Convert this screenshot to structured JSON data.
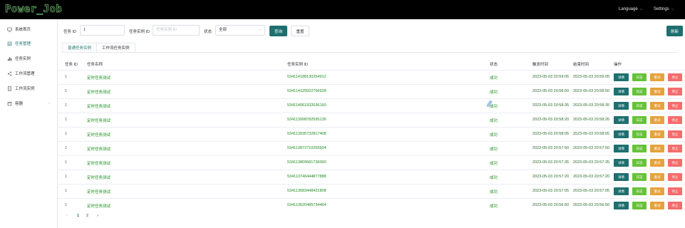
{
  "header": {
    "logo": "Power_Job",
    "language_label": "Language",
    "settings_label": "Settings"
  },
  "sidebar": {
    "items": [
      {
        "label": "系统首页",
        "icon": "monitor-icon"
      },
      {
        "label": "任务管理",
        "icon": "task-icon",
        "active": true
      },
      {
        "label": "任务实例",
        "icon": "bar-chart-icon"
      },
      {
        "label": "工作流管理",
        "icon": "share-icon"
      },
      {
        "label": "工作流实例",
        "icon": "document-icon"
      },
      {
        "label": "容器",
        "icon": "box-icon",
        "expandable": true
      }
    ]
  },
  "filters": {
    "task_id_label": "任务 ID",
    "task_id_value": "1",
    "instance_id_label": "任务实例 ID",
    "instance_id_placeholder": "任务实例 ID",
    "status_label": "状态",
    "status_value": "全部",
    "query_label": "查询",
    "reset_label": "重置",
    "refresh_label": "刷新"
  },
  "tabs": [
    {
      "label": "普通任务实例",
      "active": true
    },
    {
      "label": "工作流任务实例",
      "active": false
    }
  ],
  "table": {
    "headers": [
      "任务 ID",
      "任务名称",
      "任务实例 ID",
      "状态",
      "触发时间",
      "结束时间",
      "操作"
    ],
    "rows": [
      {
        "task_id": "1",
        "name": "定时任务测试",
        "instance_id": "534114188130254912",
        "status": "成功",
        "trigger": "2023-05-03 20:59:05",
        "end": "2023-05-03 20:59:05"
      },
      {
        "task_id": "1",
        "name": "定时任务测试",
        "instance_id": "534114125022756928",
        "status": "成功",
        "trigger": "2023-05-03 20:58:50",
        "end": "2023-05-03 20:58:50"
      },
      {
        "task_id": "1",
        "name": "定时任务测试",
        "instance_id": "534114061932036160",
        "status": "成功",
        "trigger": "2023-05-03 20:58:35",
        "end": "2023-05-03 20:58:35"
      },
      {
        "task_id": "1",
        "name": "定时任务测试",
        "instance_id": "534113998782595136",
        "status": "成功",
        "trigger": "2023-05-03 20:58:20",
        "end": "2023-05-03 20:58:20"
      },
      {
        "task_id": "1",
        "name": "定时任务测试",
        "instance_id": "534113935732817408",
        "status": "成功",
        "trigger": "2023-05-03 20:58:05",
        "end": "2023-05-03 20:58:05"
      },
      {
        "task_id": "1",
        "name": "定时任务测试",
        "instance_id": "534113872710255504",
        "status": "成功",
        "trigger": "2023-05-03 20:57:50",
        "end": "2023-05-03 20:57:50"
      },
      {
        "task_id": "1",
        "name": "定时任务测试",
        "instance_id": "534113809581736000",
        "status": "成功",
        "trigger": "2023-05-03 20:57:35",
        "end": "2023-05-03 20:57:35"
      },
      {
        "task_id": "1",
        "name": "定时任务测试",
        "instance_id": "534113746444877888",
        "status": "成功",
        "trigger": "2023-05-03 20:57:20",
        "end": "2023-05-03 20:57:20"
      },
      {
        "task_id": "1",
        "name": "定时任务测试",
        "instance_id": "534113683448431808",
        "status": "成功",
        "trigger": "2023-05-03 20:57:05",
        "end": "2023-05-03 20:57:05"
      },
      {
        "task_id": "1",
        "name": "定时任务测试",
        "instance_id": "534113620485734464",
        "status": "成功",
        "trigger": "2023-05-03 20:56:50",
        "end": "2023-05-03 20:56:50"
      }
    ],
    "actions": {
      "detail": "详情",
      "run": "日志",
      "copy": "重试",
      "stop": "停止"
    }
  },
  "pagination": {
    "prev": "‹",
    "pages": [
      "1",
      "2"
    ],
    "next": "›"
  },
  "colors": {
    "primary": "#1f6f6f",
    "success": "#67c23a",
    "warning": "#e6a23c",
    "danger": "#f56c6c",
    "status_green": "#1d8a1d"
  }
}
